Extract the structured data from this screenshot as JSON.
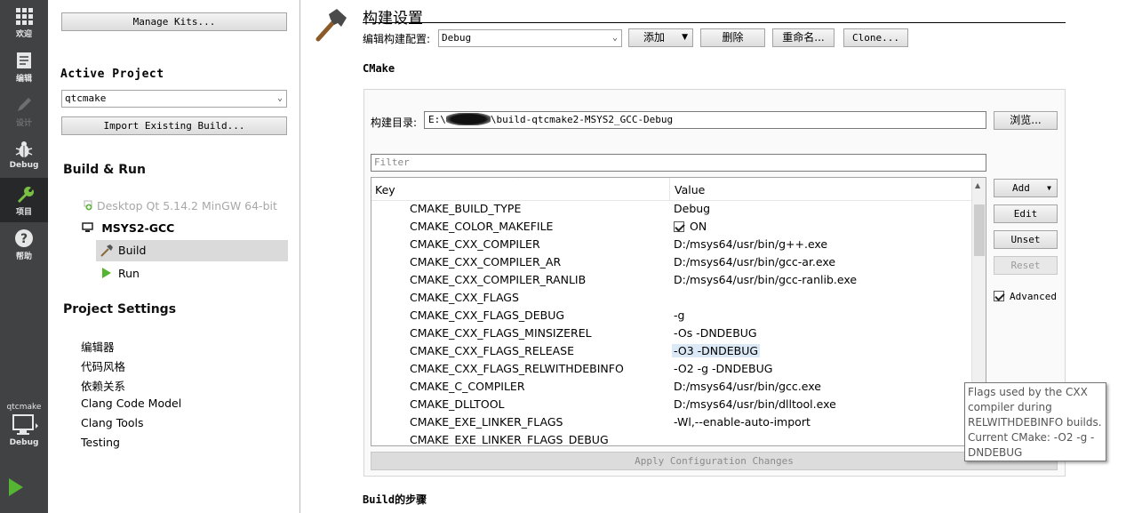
{
  "modebar": {
    "modes": [
      {
        "label": "欢迎",
        "icon": "grid-icon"
      },
      {
        "label": "编辑",
        "icon": "document-icon"
      },
      {
        "label": "设计",
        "icon": "pencil-icon"
      },
      {
        "label": "Debug",
        "icon": "bug-icon"
      },
      {
        "label": "项目",
        "icon": "wrench-icon"
      },
      {
        "label": "帮助",
        "icon": "help-icon"
      }
    ],
    "kit": {
      "project": "qtcmake",
      "config": "Debug"
    }
  },
  "nav": {
    "manage_kits": "Manage Kits...",
    "active_project_heading": "Active Project",
    "project_combo": "qtcmake",
    "import_build": "Import Existing Build...",
    "build_run_heading": "Build & Run",
    "kit_inactive": "Desktop Qt 5.14.2 MinGW 64-bit",
    "kit_active": "MSYS2-GCC",
    "build_item": "Build",
    "run_item": "Run",
    "project_settings_heading": "Project Settings",
    "settings_items": [
      "编辑器",
      "代码风格",
      "依赖关系",
      "Clang Code Model",
      "Clang Tools",
      "Testing"
    ]
  },
  "main": {
    "title": "构建设置",
    "edit_config_label": "编辑构建配置:",
    "config_combo": "Debug",
    "add_button": "添加",
    "delete_button": "删除",
    "rename_button": "重命名...",
    "clone_button": "Clone...",
    "cmake_heading": "CMake",
    "build_dir_label": "构建目录:",
    "build_dir_prefix": "E:\\",
    "build_dir_suffix": "\\build-qtcmake2-MSYS2_GCC-Debug",
    "browse_button": "浏览...",
    "filter_placeholder": "Filter",
    "table_headers": {
      "key": "Key",
      "value": "Value"
    },
    "rows": [
      {
        "key": "CMAKE_BUILD_TYPE",
        "value": "Debug"
      },
      {
        "key": "CMAKE_COLOR_MAKEFILE",
        "value": "ON",
        "checkbox": true
      },
      {
        "key": "CMAKE_CXX_COMPILER",
        "value": "D:/msys64/usr/bin/g++.exe"
      },
      {
        "key": "CMAKE_CXX_COMPILER_AR",
        "value": "D:/msys64/usr/bin/gcc-ar.exe"
      },
      {
        "key": "CMAKE_CXX_COMPILER_RANLIB",
        "value": "D:/msys64/usr/bin/gcc-ranlib.exe"
      },
      {
        "key": "CMAKE_CXX_FLAGS",
        "value": ""
      },
      {
        "key": "CMAKE_CXX_FLAGS_DEBUG",
        "value": "-g"
      },
      {
        "key": "CMAKE_CXX_FLAGS_MINSIZEREL",
        "value": "-Os -DNDEBUG"
      },
      {
        "key": "CMAKE_CXX_FLAGS_RELEASE",
        "value": "-O3 -DNDEBUG",
        "selected": true
      },
      {
        "key": "CMAKE_CXX_FLAGS_RELWITHDEBINFO",
        "value": "-O2 -g -DNDEBUG"
      },
      {
        "key": "CMAKE_C_COMPILER",
        "value": "D:/msys64/usr/bin/gcc.exe"
      },
      {
        "key": "CMAKE_DLLTOOL",
        "value": "D:/msys64/usr/bin/dlltool.exe"
      },
      {
        "key": "CMAKE_EXE_LINKER_FLAGS",
        "value": "-Wl,--enable-auto-import"
      },
      {
        "key": "CMAKE_EXE_LINKER_FLAGS_DEBUG",
        "value": ""
      }
    ],
    "side_buttons": {
      "add": "Add",
      "edit": "Edit",
      "unset": "Unset",
      "reset": "Reset"
    },
    "advanced_label": "Advanced",
    "apply_button": "Apply Configuration Changes",
    "build_steps_heading": "Build的步骤",
    "tooltip": "Flags used by the CXX compiler during RELWITHDEBINFO builds. Current CMake: -O2 -g -DNDEBUG"
  }
}
